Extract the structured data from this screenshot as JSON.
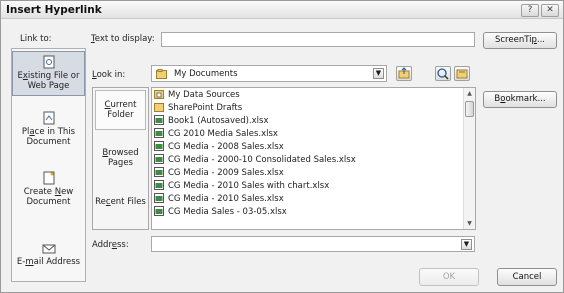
{
  "window": {
    "title": "Insert Hyperlink",
    "help_glyph": "?",
    "close_glyph": "✕"
  },
  "link_to": {
    "label": "Link to:",
    "items": [
      {
        "pre": "E",
        "mn": "x",
        "post": "isting File or Web Page",
        "selected": true
      },
      {
        "pre": "Pl",
        "mn": "a",
        "post": "ce in This Document",
        "selected": false
      },
      {
        "pre": "Create ",
        "mn": "N",
        "post": "ew Document",
        "selected": false
      },
      {
        "pre": "E-",
        "mn": "m",
        "post": "ail Address",
        "selected": false
      }
    ]
  },
  "text_to_display": {
    "pre": "",
    "mn": "T",
    "post": "ext to display:",
    "value": ""
  },
  "screentip": {
    "pre": "ScreenTi",
    "mn": "p",
    "post": "..."
  },
  "look_in": {
    "pre": "",
    "mn": "L",
    "post": "ook in:",
    "value": "My Documents"
  },
  "bookmark": {
    "pre": "B",
    "mn": "o",
    "post": "okmark..."
  },
  "scope": [
    {
      "pre": "",
      "mn": "C",
      "post": "urrent Folder",
      "selected": true
    },
    {
      "pre": "",
      "mn": "B",
      "post": "rowsed Pages",
      "selected": false
    },
    {
      "pre": "Re",
      "mn": "c",
      "post": "ent Files",
      "selected": false
    }
  ],
  "files": [
    {
      "name": "My Data Sources",
      "icon": "folder-data-icon"
    },
    {
      "name": "SharePoint Drafts",
      "icon": "folder-icon"
    },
    {
      "name": "Book1 (Autosaved).xlsx",
      "icon": "excel-file-icon"
    },
    {
      "name": "CG 2010 Media Sales.xlsx",
      "icon": "excel-file-icon"
    },
    {
      "name": "CG Media - 2008 Sales.xlsx",
      "icon": "excel-file-icon"
    },
    {
      "name": "CG Media - 2000-10 Consolidated Sales.xlsx",
      "icon": "excel-file-icon"
    },
    {
      "name": "CG Media - 2009 Sales.xlsx",
      "icon": "excel-file-icon"
    },
    {
      "name": "CG Media - 2010 Sales with chart.xlsx",
      "icon": "excel-file-icon"
    },
    {
      "name": "CG Media - 2010 Sales.xlsx",
      "icon": "excel-file-icon"
    },
    {
      "name": "CG Media Sales - 03-05.xlsx",
      "icon": "excel-file-icon"
    }
  ],
  "address": {
    "pre": "Addr",
    "mn": "e",
    "post": "ss:",
    "value": ""
  },
  "buttons": {
    "ok": "OK",
    "cancel": "Cancel"
  },
  "colors": {
    "selected_bg": "#d6dbe4",
    "dialog_bg": "#f1f1f1"
  }
}
